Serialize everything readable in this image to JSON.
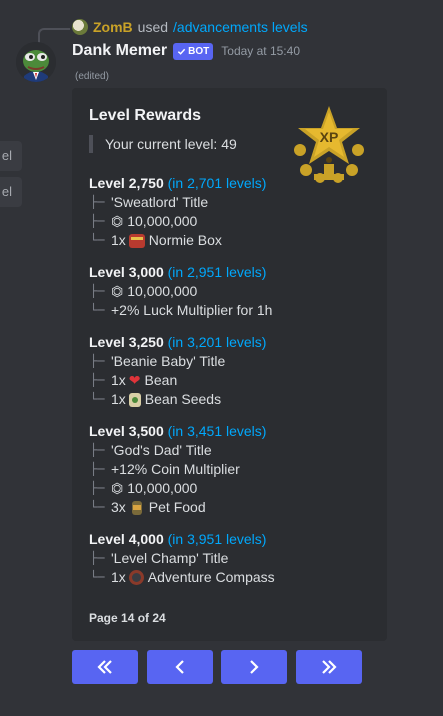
{
  "left_edge": [
    {
      "label": "el"
    },
    {
      "label": "el"
    }
  ],
  "reply": {
    "user": "ZomB",
    "used_text": "used",
    "command": "/advancements levels"
  },
  "message": {
    "author": "Dank Memer",
    "bot_tag": "BOT",
    "timestamp": "Today at 15:40",
    "edited": "(edited)"
  },
  "embed": {
    "title": "Level Rewards",
    "current_level": "Your current level: 49",
    "footer": "Page 14 of 24",
    "groups": [
      {
        "level": "Level 2,750",
        "remaining": "(in 2,701 levels)",
        "items": [
          {
            "text": "'Sweatlord' Title",
            "icon": ""
          },
          {
            "text": "10,000,000",
            "icon": "coin-icon"
          },
          {
            "text": "Normie Box",
            "prefix": "1x",
            "icon": "normie-box-icon"
          }
        ]
      },
      {
        "level": "Level 3,000",
        "remaining": "(in 2,951 levels)",
        "items": [
          {
            "text": "10,000,000",
            "icon": "coin-icon"
          },
          {
            "text": "+2% Luck Multiplier for 1h",
            "icon": ""
          }
        ]
      },
      {
        "level": "Level 3,250",
        "remaining": "(in 3,201 levels)",
        "items": [
          {
            "text": "'Beanie Baby' Title",
            "icon": ""
          },
          {
            "text": "Bean",
            "prefix": "1x",
            "icon": "bean-icon"
          },
          {
            "text": "Bean Seeds",
            "prefix": "1x",
            "icon": "bean-seeds-icon"
          }
        ]
      },
      {
        "level": "Level 3,500",
        "remaining": "(in 3,451 levels)",
        "items": [
          {
            "text": "'God's Dad' Title",
            "icon": ""
          },
          {
            "text": "+12% Coin Multiplier",
            "icon": ""
          },
          {
            "text": "10,000,000",
            "icon": "coin-icon"
          },
          {
            "text": "Pet Food",
            "prefix": "3x",
            "icon": "pet-food-icon"
          }
        ]
      },
      {
        "level": "Level 4,000",
        "remaining": "(in 3,951 levels)",
        "items": [
          {
            "text": "'Level Champ' Title",
            "icon": ""
          },
          {
            "text": "Adventure Compass",
            "prefix": "1x",
            "icon": "compass-icon"
          }
        ]
      }
    ]
  },
  "buttons": [
    {
      "name": "first-page-button",
      "icon": "double-chevron-left-icon"
    },
    {
      "name": "previous-page-button",
      "icon": "chevron-left-icon"
    },
    {
      "name": "next-page-button",
      "icon": "chevron-right-icon"
    },
    {
      "name": "last-page-button",
      "icon": "double-chevron-right-icon"
    }
  ],
  "colors": {
    "background": "#313338",
    "embed": "#2b2d31",
    "link": "#00a8fc",
    "button": "#5865f2",
    "bot_tag": "#5865f2"
  }
}
